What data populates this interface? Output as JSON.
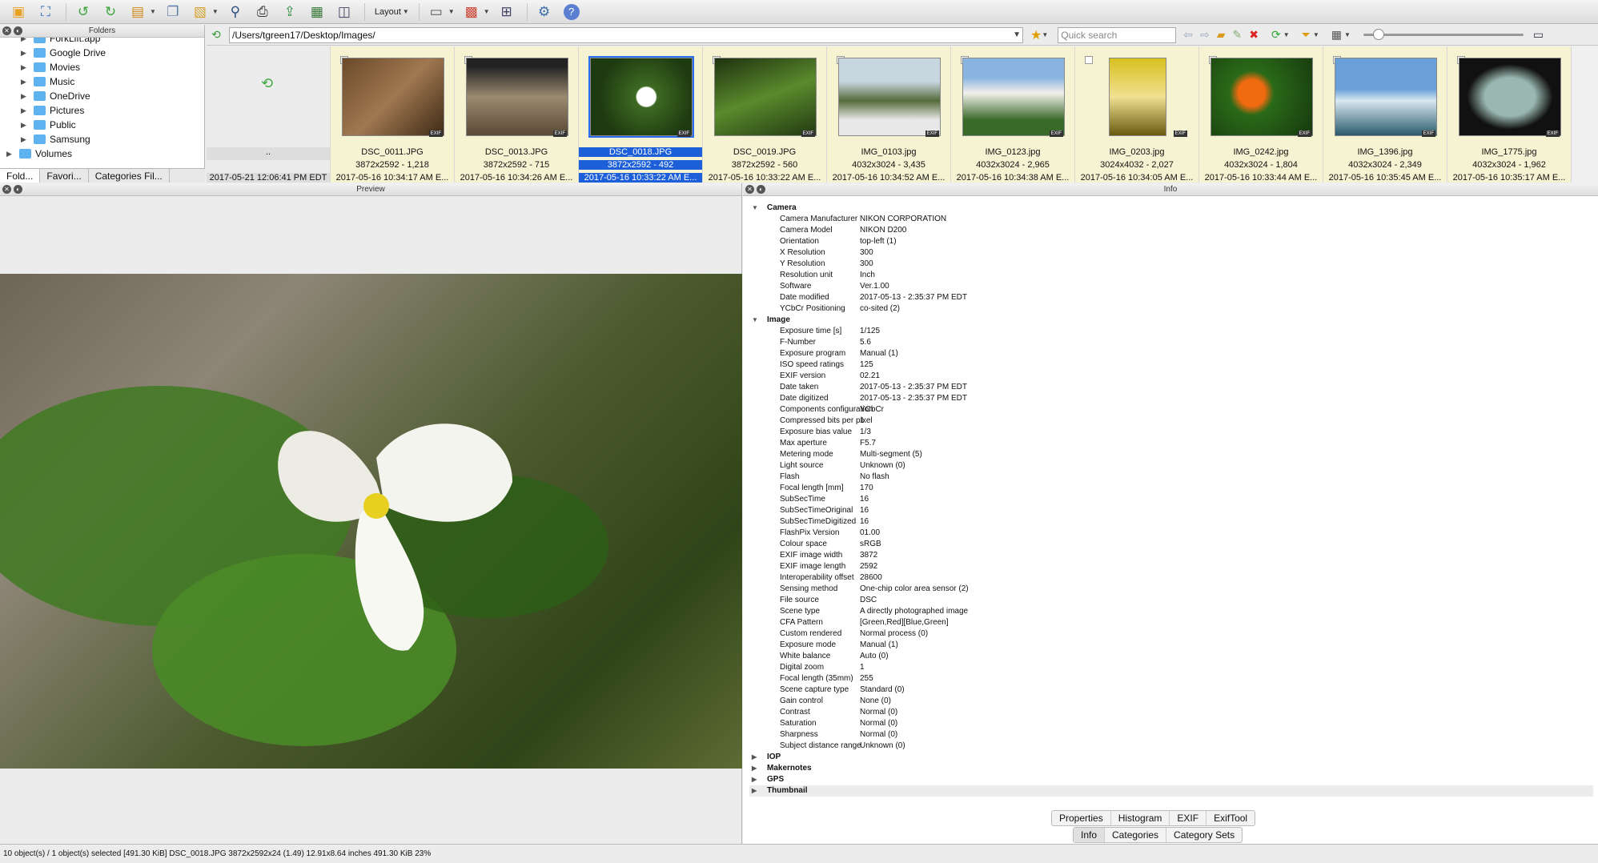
{
  "toolbar": {
    "layout_label": "Layout",
    "icons": [
      "open-icon",
      "fullscreen-icon",
      "rotate-left-icon",
      "rotate-right-icon",
      "batch-icon",
      "copy-icon",
      "move-icon",
      "find-icon",
      "print-icon",
      "export-icon",
      "slideshow-icon",
      "screenshot-icon",
      "layout-icon",
      "view-icon",
      "tag-icon",
      "compare-icon",
      "settings-icon",
      "help-icon"
    ]
  },
  "folders": {
    "title": "Folders",
    "items": [
      "ForkLift.app",
      "Google Drive",
      "Movies",
      "Music",
      "OneDrive",
      "Pictures",
      "Public",
      "Samsung"
    ],
    "root_item": "Volumes",
    "tabs": [
      "Fold...",
      "Favori...",
      "Categories Fil..."
    ]
  },
  "path": {
    "value": "/Users/tgreen17/Desktop/Images/",
    "search_placeholder": "Quick search"
  },
  "thumbnails": {
    "parent": {
      "name": "..",
      "date": "2017-05-21 12:06:41 PM EDT"
    },
    "items": [
      {
        "name": "DSC_0011.JPG",
        "info": "3872x2592 - 1,218",
        "date": "2017-05-16 10:34:17 AM E..."
      },
      {
        "name": "DSC_0013.JPG",
        "info": "3872x2592 - 715",
        "date": "2017-05-16 10:34:26 AM E..."
      },
      {
        "name": "DSC_0018.JPG",
        "info": "3872x2592 - 492",
        "date": "2017-05-16 10:33:22 AM E..."
      },
      {
        "name": "DSC_0019.JPG",
        "info": "3872x2592 - 560",
        "date": "2017-05-16 10:33:22 AM E..."
      },
      {
        "name": "IMG_0103.jpg",
        "info": "4032x3024 - 3,435",
        "date": "2017-05-16 10:34:52 AM E..."
      },
      {
        "name": "IMG_0123.jpg",
        "info": "4032x3024 - 2,965",
        "date": "2017-05-16 10:34:38 AM E..."
      },
      {
        "name": "IMG_0203.jpg",
        "info": "3024x4032 - 2,027",
        "date": "2017-05-16 10:34:05 AM E..."
      },
      {
        "name": "IMG_0242.jpg",
        "info": "4032x3024 - 1,804",
        "date": "2017-05-16 10:33:44 AM E..."
      },
      {
        "name": "IMG_1396.jpg",
        "info": "4032x3024 - 2,349",
        "date": "2017-05-16 10:35:45 AM E..."
      },
      {
        "name": "IMG_1775.jpg",
        "info": "4032x3024 - 1,962",
        "date": "2017-05-16 10:35:17 AM E..."
      }
    ]
  },
  "preview": {
    "title": "Preview"
  },
  "info": {
    "title": "Info",
    "groups": [
      {
        "name": "Camera",
        "rows": [
          [
            "Camera Manufacturer",
            "NIKON CORPORATION"
          ],
          [
            "Camera Model",
            "NIKON D200"
          ],
          [
            "Orientation",
            "top-left (1)"
          ],
          [
            "X Resolution",
            "300"
          ],
          [
            "Y Resolution",
            "300"
          ],
          [
            "Resolution unit",
            "Inch"
          ],
          [
            "Software",
            "Ver.1.00"
          ],
          [
            "Date modified",
            "2017-05-13 - 2:35:37 PM EDT"
          ],
          [
            "YCbCr Positioning",
            "co-sited (2)"
          ]
        ]
      },
      {
        "name": "Image",
        "rows": [
          [
            "Exposure time [s]",
            "1/125"
          ],
          [
            "F-Number",
            "5.6"
          ],
          [
            "Exposure program",
            "Manual (1)"
          ],
          [
            "ISO speed ratings",
            "125"
          ],
          [
            "EXIF version",
            "02.21"
          ],
          [
            "Date taken",
            "2017-05-13 - 2:35:37 PM EDT"
          ],
          [
            "Date digitized",
            "2017-05-13 - 2:35:37 PM EDT"
          ],
          [
            "Components configuration",
            "YCbCr"
          ],
          [
            "Compressed bits per pixel",
            "1"
          ],
          [
            "Exposure bias value",
            "1/3"
          ],
          [
            "Max aperture",
            "F5.7"
          ],
          [
            "Metering mode",
            "Multi-segment (5)"
          ],
          [
            "Light source",
            "Unknown (0)"
          ],
          [
            "Flash",
            "No flash"
          ],
          [
            "Focal length [mm]",
            "170"
          ],
          [
            "SubSecTime",
            "16"
          ],
          [
            "SubSecTimeOriginal",
            "16"
          ],
          [
            "SubSecTimeDigitized",
            "16"
          ],
          [
            "FlashPix Version",
            "01.00"
          ],
          [
            "Colour space",
            "sRGB"
          ],
          [
            "EXIF image width",
            "3872"
          ],
          [
            "EXIF image length",
            "2592"
          ],
          [
            "Interoperability offset",
            "28600"
          ],
          [
            "Sensing method",
            "One-chip color area sensor (2)"
          ],
          [
            "File source",
            "DSC"
          ],
          [
            "Scene type",
            "A directly photographed image"
          ],
          [
            "CFA Pattern",
            "[Green,Red][Blue,Green]"
          ],
          [
            "Custom rendered",
            "Normal process (0)"
          ],
          [
            "Exposure mode",
            "Manual (1)"
          ],
          [
            "White balance",
            "Auto (0)"
          ],
          [
            "Digital zoom",
            "1"
          ],
          [
            "Focal length (35mm)",
            "255"
          ],
          [
            "Scene capture type",
            "Standard (0)"
          ],
          [
            "Gain control",
            "None (0)"
          ],
          [
            "Contrast",
            "Normal (0)"
          ],
          [
            "Saturation",
            "Normal (0)"
          ],
          [
            "Sharpness",
            "Normal (0)"
          ],
          [
            "Subject distance range",
            "Unknown (0)"
          ]
        ]
      }
    ],
    "collapsed": [
      "IOP",
      "Makernotes",
      "GPS",
      "Thumbnail"
    ],
    "tabs_row1": [
      "Properties",
      "Histogram",
      "EXIF",
      "ExifTool"
    ],
    "tabs_row2": [
      "Info",
      "Categories",
      "Category Sets"
    ]
  },
  "status": "10 object(s) / 1 object(s) selected [491.30 KiB]   DSC_0018.JPG   3872x2592x24 (1.49)   12.91x8.64 inches   491.30 KiB   23%",
  "colors": {
    "selection": "#1c5fd8",
    "thumb_bg": "#f6f3d3",
    "folder": "#5eb2ef"
  }
}
